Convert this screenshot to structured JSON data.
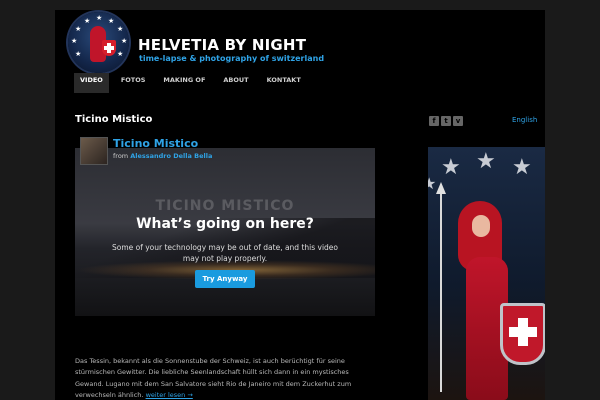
{
  "site": {
    "title": "HELVETIA BY NIGHT",
    "tagline": "time-lapse & photography of switzerland"
  },
  "nav": {
    "items": [
      {
        "label": "VIDEO",
        "active": true
      },
      {
        "label": "FOTOS",
        "active": false
      },
      {
        "label": "MAKING OF",
        "active": false
      },
      {
        "label": "ABOUT",
        "active": false
      },
      {
        "label": "KONTAKT",
        "active": false
      }
    ]
  },
  "page": {
    "title": "Ticino Mistico"
  },
  "social": {
    "icons": [
      "facebook-icon",
      "twitter-icon",
      "vimeo-icon"
    ],
    "glyphs": [
      "f",
      "t",
      "v"
    ]
  },
  "language": "English",
  "video": {
    "title": "Ticino Mistico",
    "from_label": "from",
    "author": "Alessandro Della Bella",
    "watermark": "TICINO MISTICO",
    "overlay_title": "What’s going on here?",
    "overlay_message": "Some of your technology may be out of date, and this video may not play properly.",
    "button_label": "Try Anyway"
  },
  "description": {
    "text": "Das Tessin, bekannt als die Sonnenstube der Schweiz, ist auch berüchtigt für seine stürmischen Gewitter. Die liebliche Seenlandschaft hüllt sich dann in ein mystisches Gewand. Lugano mit dem San Salvatore sieht Rio de Janeiro mit dem Zuckerhut zum verwechseln ähnlich.",
    "read_more": "weiter lesen →"
  },
  "colors": {
    "accent": "#2fa3e6",
    "button": "#1a9bdf",
    "background": "#000000",
    "outer": "#1a1a1a"
  }
}
